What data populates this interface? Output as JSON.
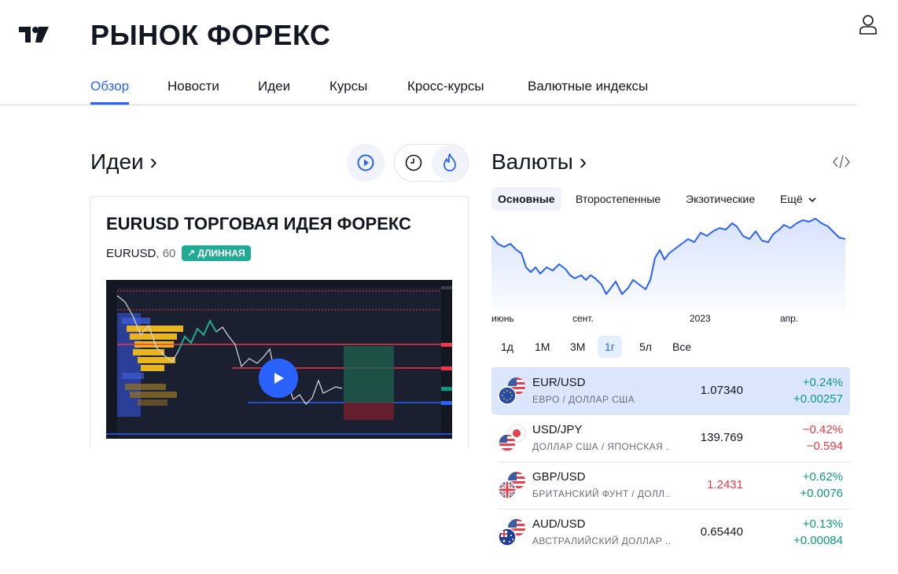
{
  "header": {
    "title": "РЫНОК ФОРЕКС"
  },
  "nav": {
    "tabs": [
      "Обзор",
      "Новости",
      "Идеи",
      "Курсы",
      "Кросс-курсы",
      "Валютные индексы"
    ],
    "active_tab": "Обзор"
  },
  "ideas": {
    "heading": "Идеи ›",
    "card": {
      "title": "EURUSD ТОРГОВАЯ ИДЕЯ ФОРЕКС",
      "symbol": "EURUSD",
      "timeframe": "60",
      "badge": "↗ ДЛИННАЯ"
    }
  },
  "currencies": {
    "heading": "Валюты ›",
    "tabs": [
      "Основные",
      "Второстепенные",
      "Экзотические",
      "Ещё"
    ],
    "active_tab": "Основные",
    "chart_axis": [
      "июнь",
      "сент.",
      "2023",
      "апр."
    ],
    "ranges": [
      "1д",
      "1М",
      "3М",
      "1г",
      "5л",
      "Все"
    ],
    "active_range": "1г",
    "rows": [
      {
        "pair": "EUR/USD",
        "desc": "ЕВРО / ДОЛЛАР США",
        "price": "1.07340",
        "change_pct": "+0.24%",
        "change_abs": "+0.00257",
        "direction": "up",
        "price_color": "neutral"
      },
      {
        "pair": "USD/JPY",
        "desc": "ДОЛЛАР США / ЯПОНСКАЯ ...",
        "price": "139.769",
        "change_pct": "−0.42%",
        "change_abs": "−0.594",
        "direction": "down",
        "price_color": "neutral"
      },
      {
        "pair": "GBP/USD",
        "desc": "БРИТАНСКИЙ ФУНТ / ДОЛЛ...",
        "price": "1.2431",
        "change_pct": "+0.62%",
        "change_abs": "+0.0076",
        "direction": "up",
        "price_color": "down"
      },
      {
        "pair": "AUD/USD",
        "desc": "АВСТРАЛИЙСКИЙ ДОЛЛАР ...",
        "price": "0.65440",
        "change_pct": "+0.13%",
        "change_abs": "+0.00084",
        "direction": "up",
        "price_color": "neutral"
      }
    ]
  },
  "icons": {
    "logo": "tradingview-logo",
    "user": "user-icon",
    "play": "play-icon",
    "recent": "clock-icon",
    "popular": "flame-icon",
    "embed": "code-icon",
    "more": "chevron-down-icon"
  },
  "colors": {
    "accent": "#2962ff",
    "up": "#089981",
    "down": "#f23645",
    "selected_row": "#dbe6fc"
  }
}
